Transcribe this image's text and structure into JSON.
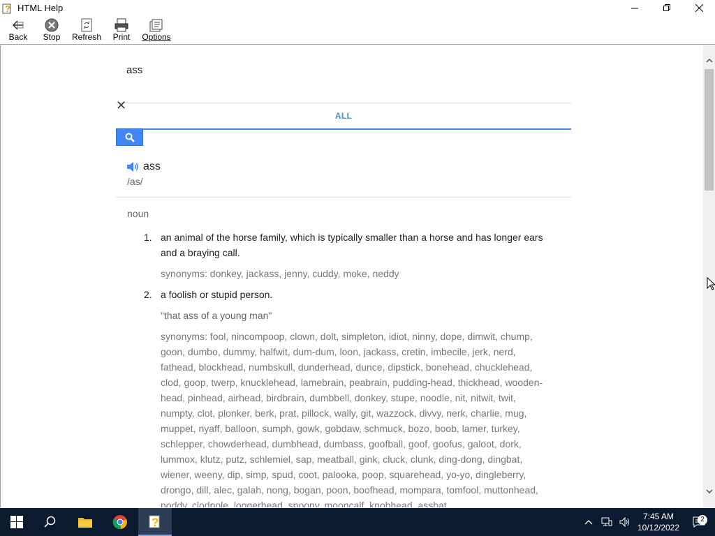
{
  "window": {
    "title": "HTML Help"
  },
  "toolbar": {
    "back": "Back",
    "stop": "Stop",
    "refresh": "Refresh",
    "print": "Print",
    "options": "Options"
  },
  "search": {
    "query": "ass",
    "tab_all": "ALL"
  },
  "entry": {
    "headword": "ass",
    "phonetic": "/as/",
    "pos": "noun",
    "senses": [
      {
        "num": "1.",
        "definition": "an animal of the horse family, which is typically smaller than a horse and has longer ears and a braying call.",
        "synonyms": "synonyms: donkey, jackass, jenny, cuddy, moke, neddy"
      },
      {
        "num": "2.",
        "definition": "a foolish or stupid person.",
        "example": "\"that ass of a young man\"",
        "synonyms": "synonyms: fool, nincompoop, clown, dolt, simpleton, idiot, ninny, dope, dimwit, chump, goon, dumbo, dummy, halfwit, dum-dum, loon, jackass, cretin, imbecile, jerk, nerd, fathead, blockhead, numbskull, dunderhead, dunce, dipstick, bonehead, chucklehead, clod, goop, twerp, knucklehead, lamebrain, peabrain, pudding-head, thickhead, wooden-head, pinhead, airhead, birdbrain, dumbbell, donkey, stupe, noodle, nit, nitwit, twit, numpty, clot, plonker, berk, prat, pillock, wally, git, wazzock, divvy, nerk, charlie, mug, muppet, nyaff, balloon, sumph, gowk, gobdaw, schmuck, bozo, boob, lamer, turkey, schlepper, chowderhead, dumbhead, dumbass, goofball, goof, goofus, galoot, dork, lummox, klutz, putz, schlemiel, sap, meatball, gink, cluck, clunk, ding-dong, dingbat, wiener, weeny, dip, simp, spud, coot, palooka, poop, squarehead, yo-yo, dingleberry, drongo, dill, alec, galah, nong, bogan, poon, boofhead, mompara, tomfool, muttonhead, noddy, clodpole, loggerhead, spoony, mooncalf, knobhead, assbat"
      }
    ]
  },
  "taskbar": {
    "time": "7:45 AM",
    "date": "10/12/2022",
    "notification_count": "2"
  },
  "colors": {
    "accent": "#4285f4",
    "tab_text": "#4a8ad0",
    "taskbar": "#0b1a2e"
  }
}
